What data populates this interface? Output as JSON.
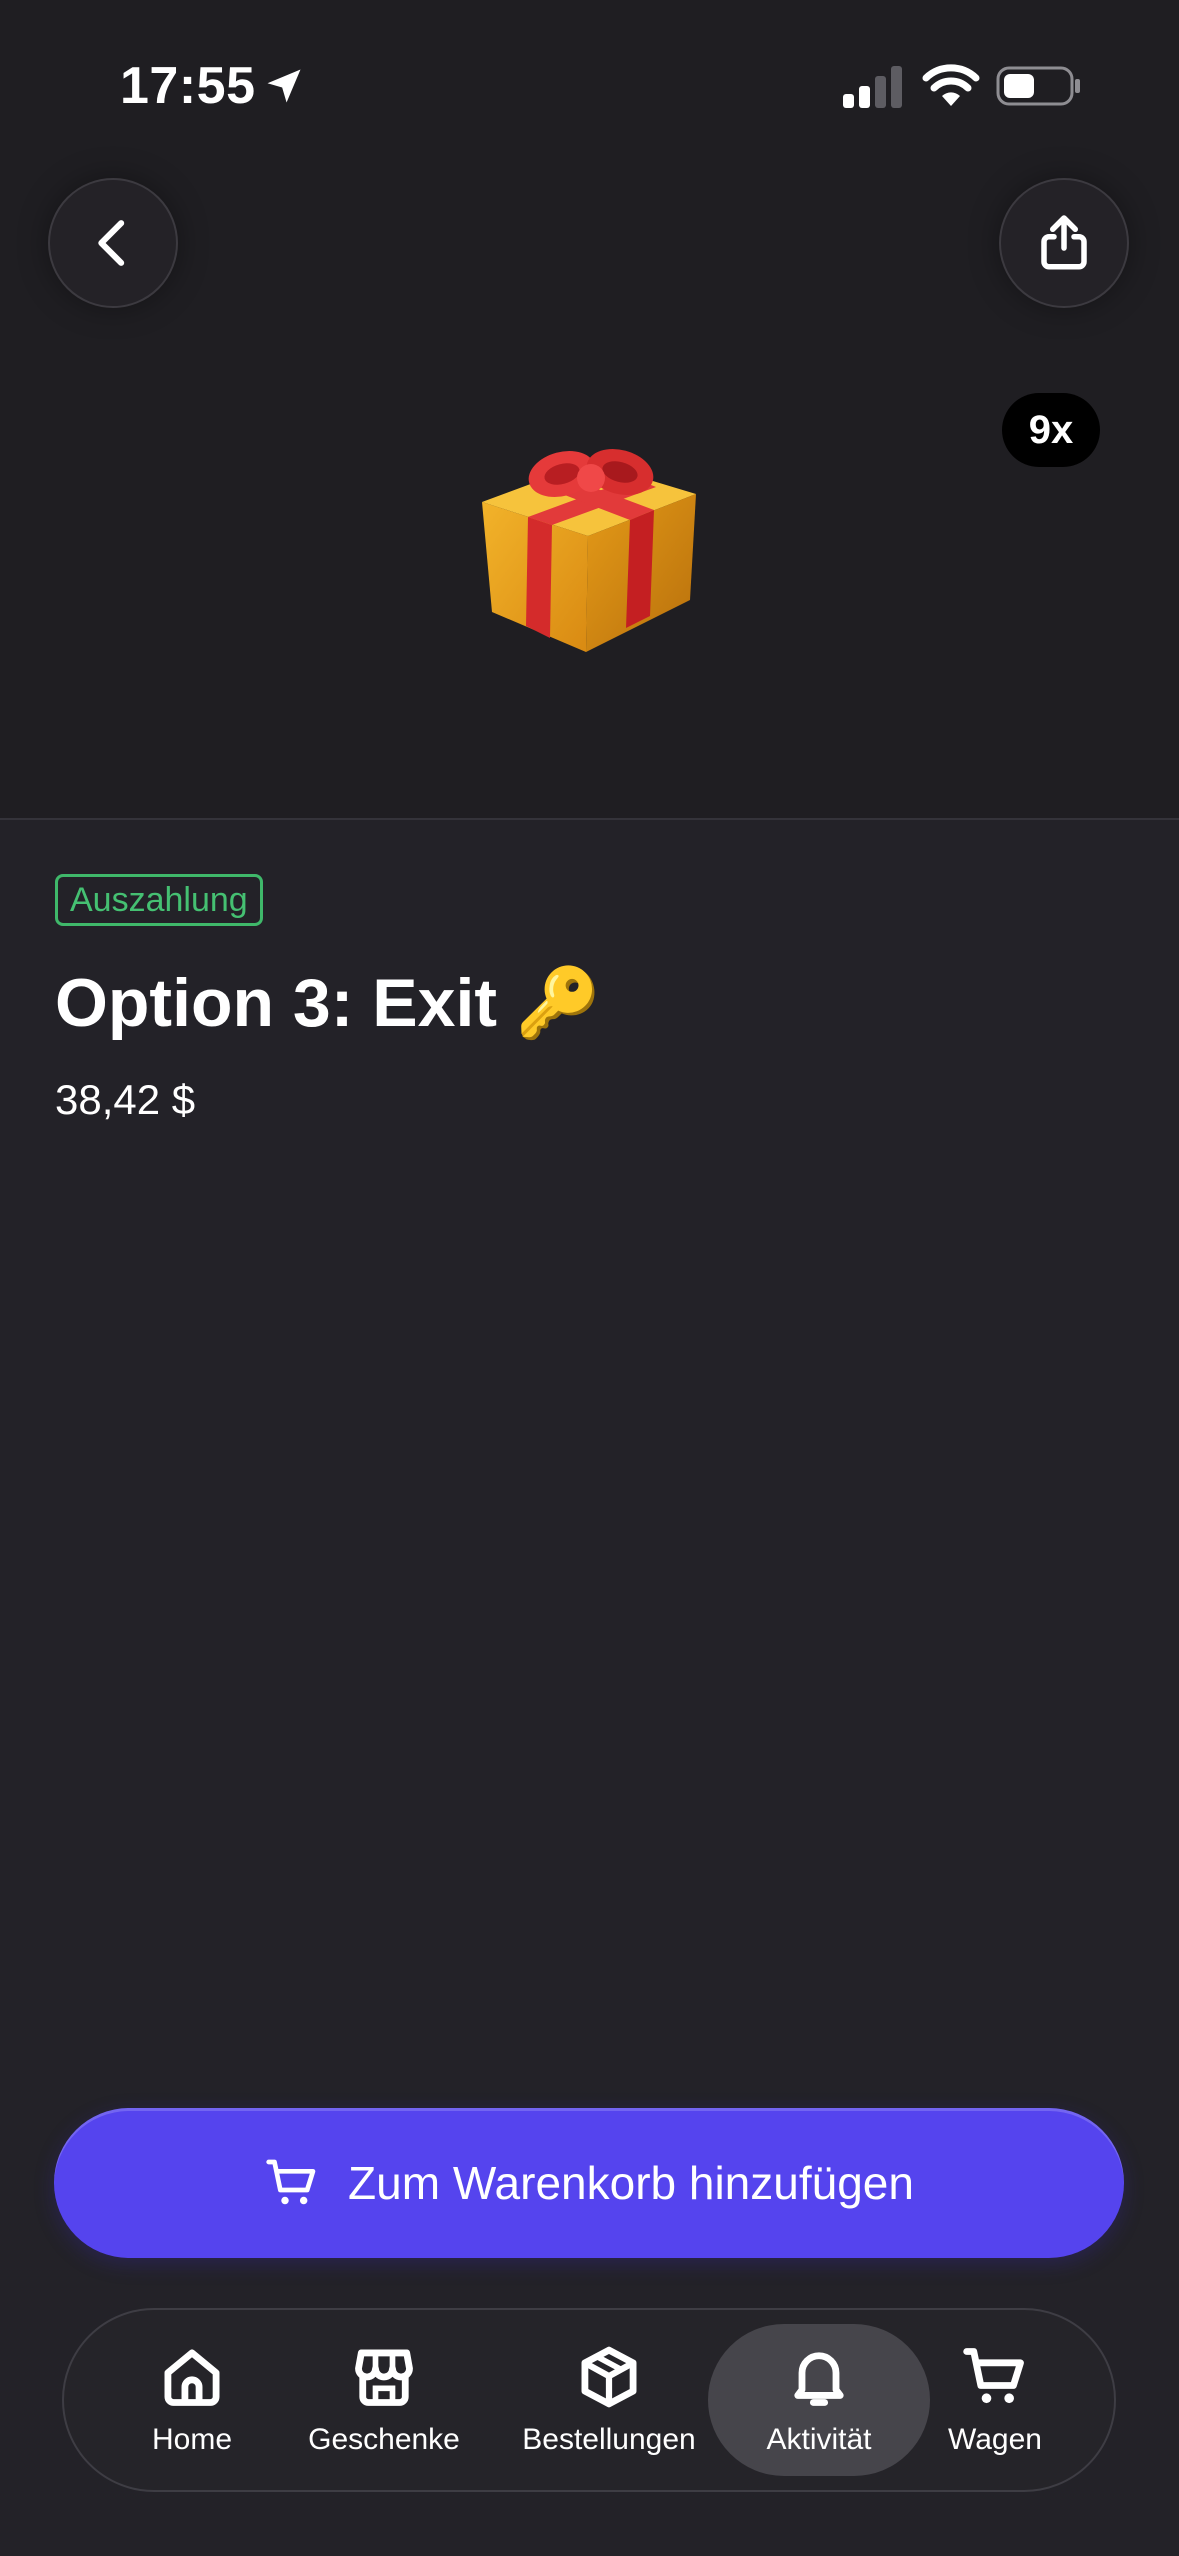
{
  "status_bar": {
    "time": "17:55"
  },
  "header": {
    "quantity_badge": "9x",
    "image_emoji": "🎁"
  },
  "product": {
    "tag": "Auszahlung",
    "title": "Option 3: Exit 🔑",
    "price": "38,42 $"
  },
  "cta": {
    "label": "Zum Warenkorb hinzufügen"
  },
  "tabs": [
    {
      "label": "Home",
      "icon": "home-icon",
      "active": false
    },
    {
      "label": "Geschenke",
      "icon": "store-icon",
      "active": false
    },
    {
      "label": "Bestellungen",
      "icon": "box-icon",
      "active": false
    },
    {
      "label": "Aktivität",
      "icon": "bell-icon",
      "active": true
    },
    {
      "label": "Wagen",
      "icon": "cart-icon",
      "active": false
    }
  ],
  "colors": {
    "accent": "#5544ee",
    "tag_green": "#45c072",
    "background": "#232228"
  }
}
